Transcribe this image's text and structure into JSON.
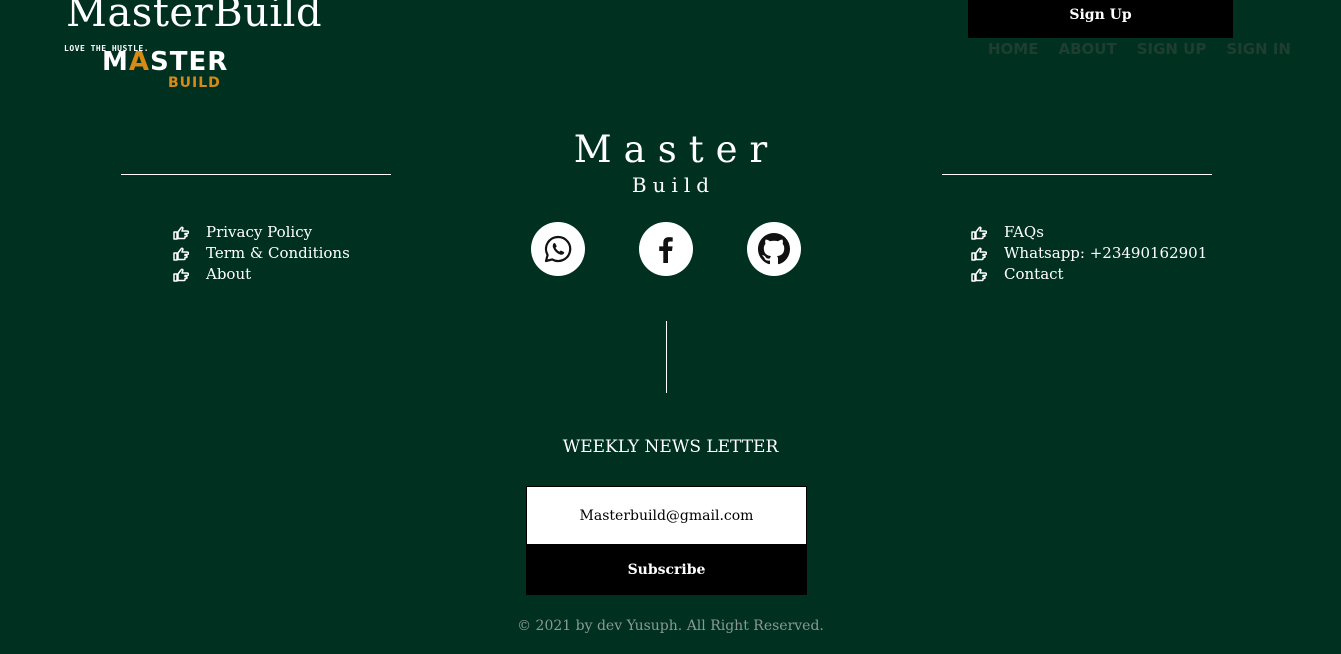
{
  "header": {
    "site_title": "MasterBuild",
    "logo": {
      "tagline": "LOVE THE HUSTLE.",
      "main_prefix": "M",
      "main_mark": "A",
      "main_suffix": "STER",
      "sub": "BUILD"
    },
    "signup_label": "Sign Up",
    "nav": [
      "HOME",
      "ABOUT",
      "SIGN UP",
      "SIGN IN"
    ]
  },
  "footer": {
    "heading_main": "Master",
    "heading_sub": "Build",
    "left_links": [
      "Privacy Policy",
      "Term & Conditions",
      "About"
    ],
    "right_links": [
      "FAQs",
      "Whatsapp: +23490162901",
      "Contact"
    ],
    "social": [
      {
        "icon": "whatsapp-icon"
      },
      {
        "icon": "facebook-icon"
      },
      {
        "icon": "github-icon"
      }
    ],
    "newsletter": {
      "title": "WEEKLY NEWS LETTER",
      "email_value": "Masterbuild@gmail.com",
      "subscribe_label": "Subscribe"
    },
    "copyright": "© 2021 by dev Yusuph. All Right Reserved."
  },
  "colors": {
    "background": "#003020",
    "accent_orange": "#d98a14",
    "button_black": "#000000",
    "nav_text": "#1e3e30",
    "copyright_text": "#8a9a93"
  }
}
